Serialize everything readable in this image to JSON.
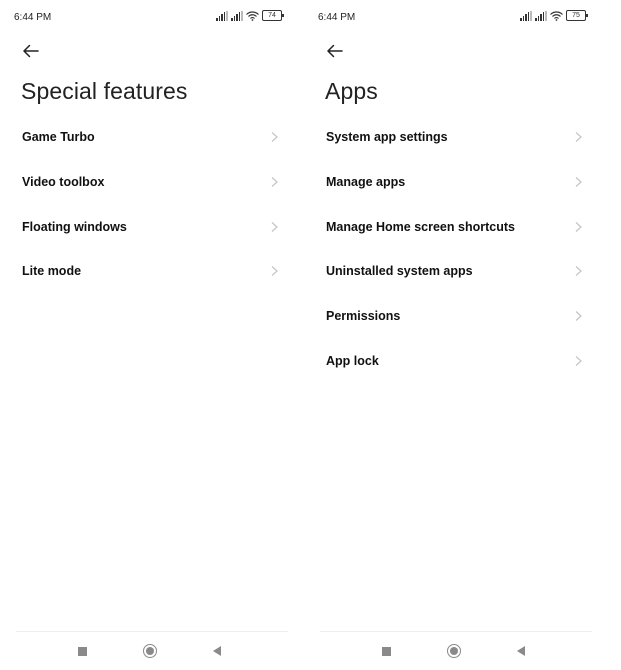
{
  "left_screen": {
    "status_bar": {
      "time": "6:44 PM",
      "battery": "74"
    },
    "title": "Special features",
    "items": [
      {
        "label": "Game Turbo"
      },
      {
        "label": "Video toolbox"
      },
      {
        "label": "Floating windows"
      },
      {
        "label": "Lite mode"
      }
    ]
  },
  "right_screen": {
    "status_bar": {
      "time": "6:44 PM",
      "battery": "75"
    },
    "title": "Apps",
    "items": [
      {
        "label": "System app settings"
      },
      {
        "label": "Manage apps"
      },
      {
        "label": "Manage Home screen shortcuts"
      },
      {
        "label": "Uninstalled system apps"
      },
      {
        "label": "Permissions"
      },
      {
        "label": "App lock"
      }
    ]
  },
  "icons": {
    "back": "arrow-left-icon",
    "chevron": "chevron-right-icon",
    "nav_recents": "square-icon",
    "nav_home": "circle-icon",
    "nav_back": "triangle-left-icon"
  },
  "colors": {
    "background": "#ffffff",
    "text": "#111111",
    "chevron": "#c4c4c4",
    "nav_icons": "#8a8a8a"
  }
}
